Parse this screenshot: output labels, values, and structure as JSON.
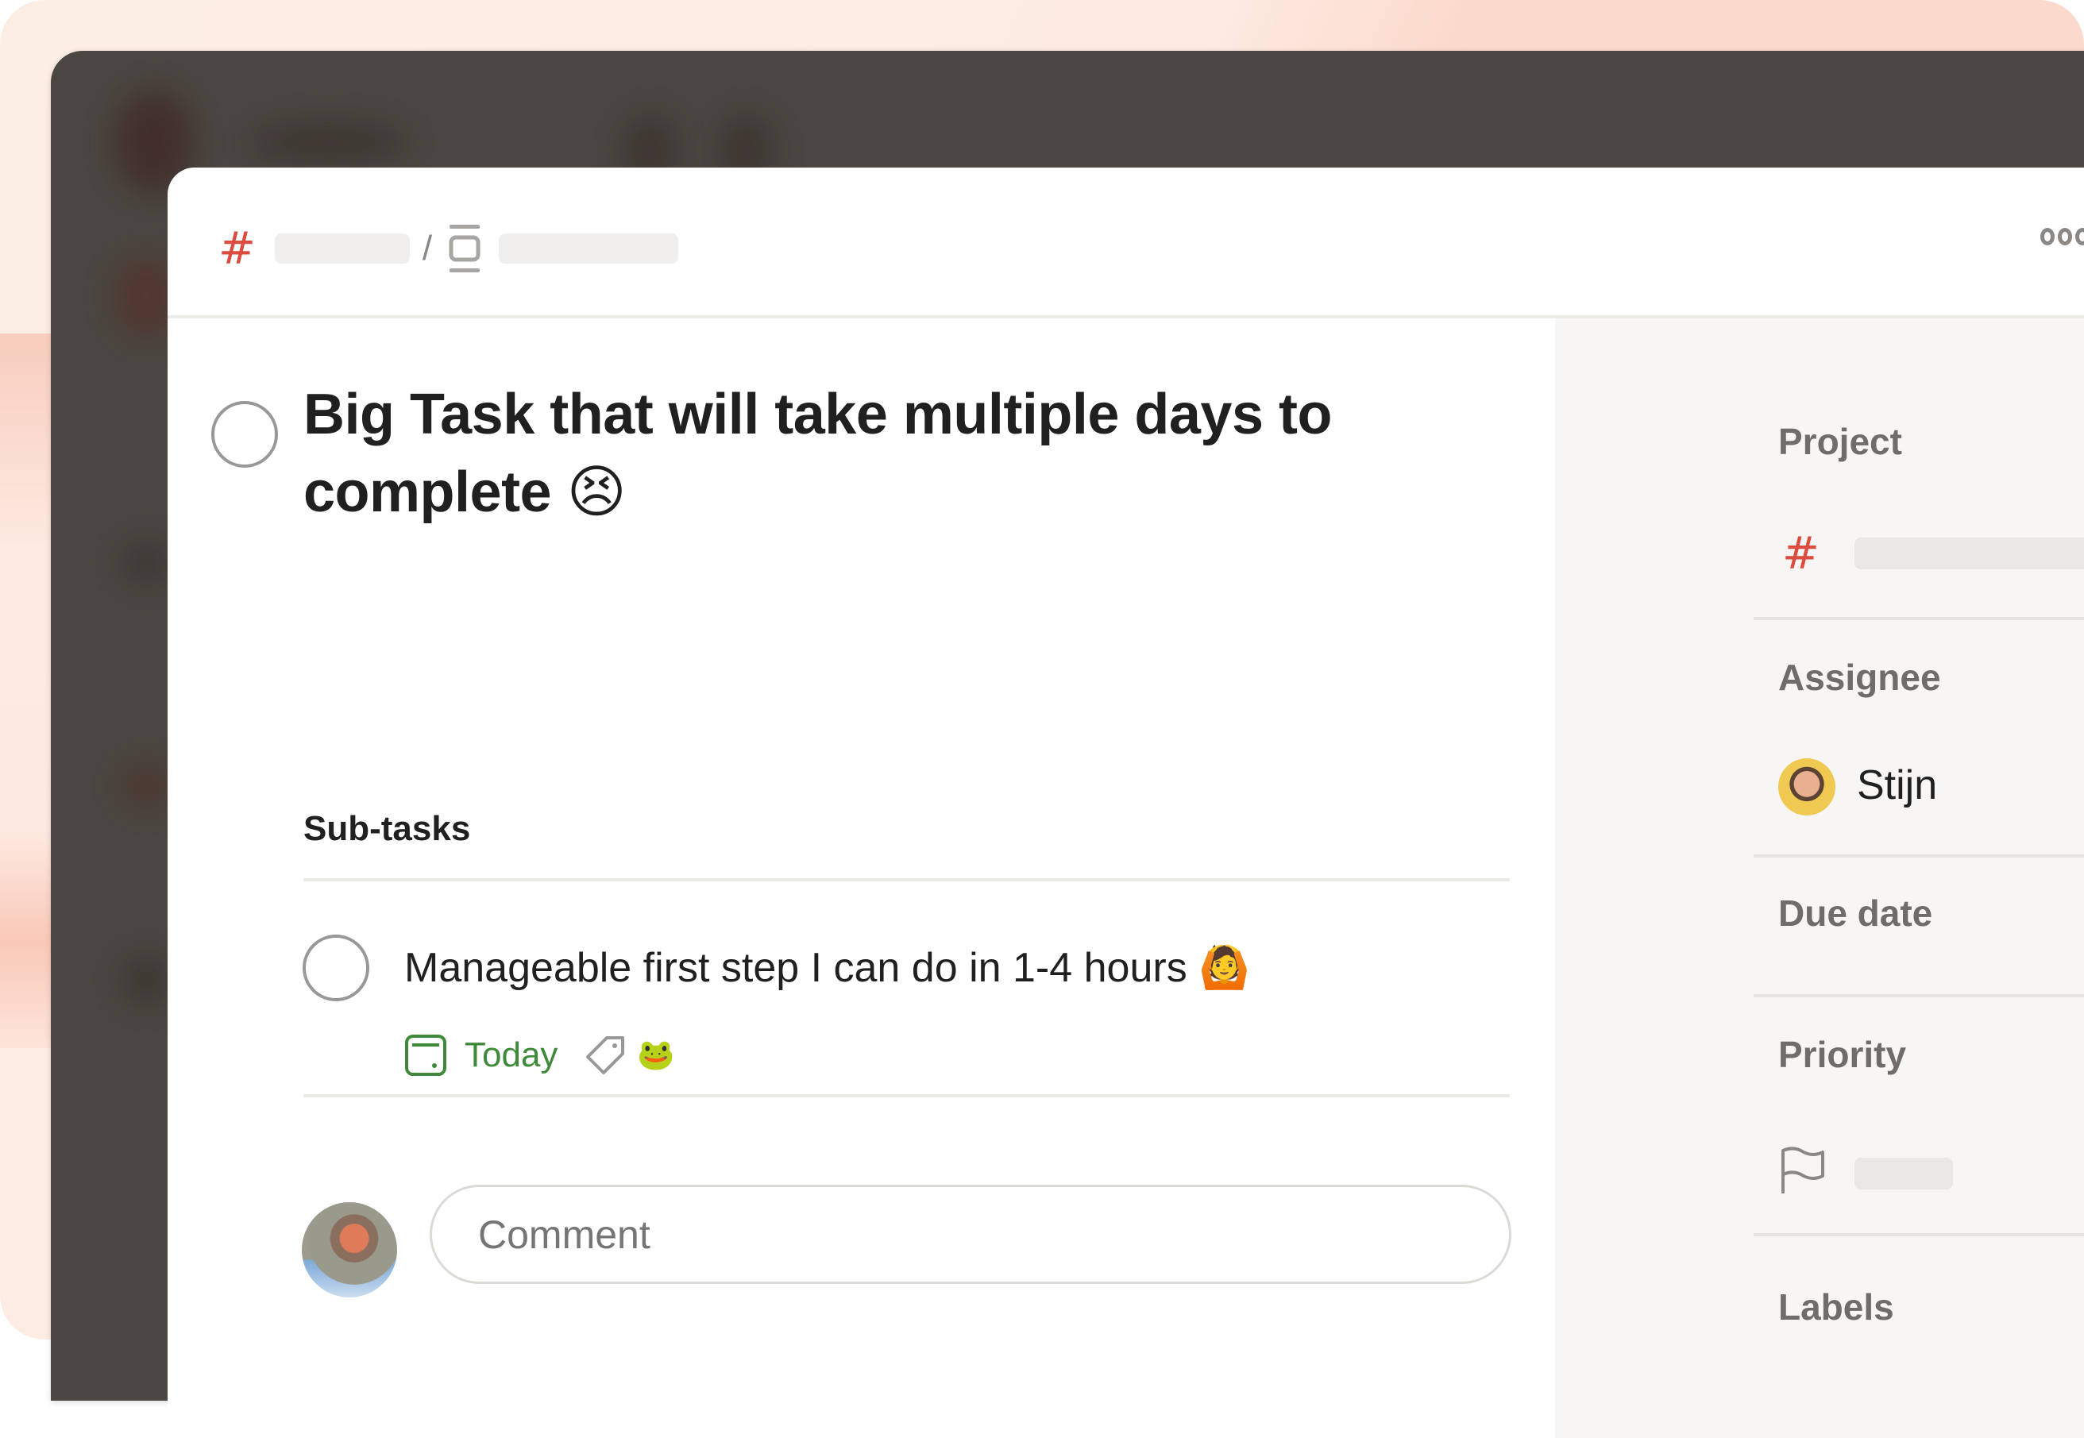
{
  "colors": {
    "accent_red": "#dc4c3e",
    "date_green": "#3e8a3a",
    "backdrop_dark": "#4a4641",
    "side_panel_bg": "#f7f6f4",
    "frame_bg": "#fdeee4"
  },
  "header": {
    "project_icon": "hash-icon",
    "separator": "/",
    "section_icon": "section-icon",
    "more_icon": "more-horizontal-icon"
  },
  "task": {
    "title": "Big Task that will take multiple days to complete 😣",
    "completed": false
  },
  "subtasks": {
    "heading": "Sub-tasks",
    "items": [
      {
        "text": "Manageable first step I can do in 1-4 hours 🙆",
        "completed": false,
        "due": "Today",
        "due_icon": "calendar-icon",
        "label_icon": "tag-icon",
        "label_emoji": "🐸"
      }
    ]
  },
  "comment": {
    "placeholder": "Comment",
    "value": ""
  },
  "sidebar": {
    "project": {
      "label": "Project",
      "icon": "hash-icon"
    },
    "assignee": {
      "label": "Assignee",
      "name": "Stijn"
    },
    "due_date": {
      "label": "Due date"
    },
    "priority": {
      "label": "Priority",
      "icon": "flag-icon"
    },
    "labels": {
      "label": "Labels"
    }
  }
}
